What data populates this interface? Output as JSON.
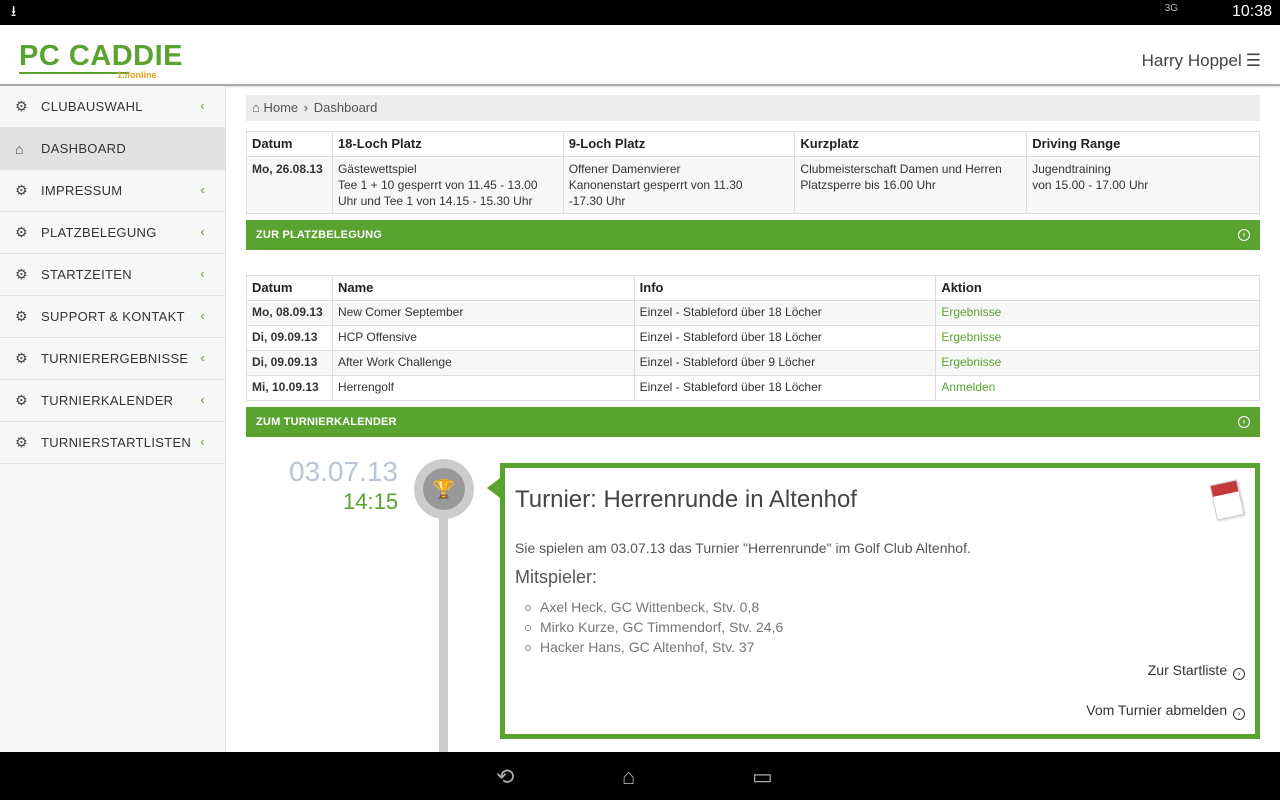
{
  "status_bar": {
    "time": "10:38",
    "download_icon": "download-icon",
    "network": "3G"
  },
  "header": {
    "logo_text": "PC CADDIE",
    "logo_sub": "1://online",
    "user_name": "Harry Hoppel",
    "menu_icon": "hamburger-icon"
  },
  "sidebar": {
    "items": [
      {
        "label": "CLUBAUSWAHL",
        "icon": "gears-icon",
        "active": false
      },
      {
        "label": "DASHBOARD",
        "icon": "home-icon",
        "active": true
      },
      {
        "label": "IMPRESSUM",
        "icon": "gears-icon",
        "active": false
      },
      {
        "label": "PLATZBELEGUNG",
        "icon": "gears-icon",
        "active": false
      },
      {
        "label": "STARTZEITEN",
        "icon": "gears-icon",
        "active": false
      },
      {
        "label": "SUPPORT & KONTAKT",
        "icon": "gears-icon",
        "active": false
      },
      {
        "label": "TURNIERERGEBNISSE",
        "icon": "gears-icon",
        "active": false
      },
      {
        "label": "TURNIERKALENDER",
        "icon": "gears-icon",
        "active": false
      },
      {
        "label": "TURNIERSTARTLISTEN",
        "icon": "gears-icon",
        "active": false
      }
    ]
  },
  "breadcrumb": {
    "home": "Home",
    "current": "Dashboard"
  },
  "occupancy": {
    "headers": [
      "Datum",
      "18-Loch Platz",
      "9-Loch Platz",
      "Kurzplatz",
      "Driving Range"
    ],
    "row": {
      "date": "Mo, 26.08.13",
      "loch18": [
        "Gästewettspiel",
        "Tee 1 + 10 gesperrt von 11.45 - 13.00",
        "Uhr und Tee 1 von 14.15 - 15.30 Uhr"
      ],
      "loch9": [
        "Offener Damenvierer",
        "Kanonenstart gesperrt von 11.30",
        "-17.30 Uhr"
      ],
      "kurz": [
        "Clubmeisterschaft Damen und Herren",
        "Platzsperre bis 16.00 Uhr"
      ],
      "range": [
        "Jugendtraining",
        "von 15.00 - 17.00 Uhr"
      ]
    },
    "button": "ZUR PLATZBELEGUNG"
  },
  "tournaments": {
    "headers": [
      "Datum",
      "Name",
      "Info",
      "Aktion"
    ],
    "rows": [
      {
        "date": "Mo, 08.09.13",
        "name": "New Comer September",
        "info": "Einzel - Stableford über 18 Löcher",
        "action": "Ergebnisse"
      },
      {
        "date": "Di, 09.09.13",
        "name": "HCP Offensive",
        "info": "Einzel - Stableford über 18 Löcher",
        "action": "Ergebnisse"
      },
      {
        "date": "Di, 09.09.13",
        "name": "After Work Challenge",
        "info": "Einzel - Stableford über 9 Löcher",
        "action": "Ergebnisse"
      },
      {
        "date": "Mi, 10.09.13",
        "name": "Herrengolf",
        "info": "Einzel - Stableford über 18 Löcher",
        "action": "Anmelden"
      }
    ],
    "button": "ZUM TURNIERKALENDER"
  },
  "timeline": {
    "date": "03.07.13",
    "time": "14:15",
    "node_icon": "trophy-icon",
    "card": {
      "title": "Turnier: Herrenrunde in Altenhof",
      "text": "Sie spielen am 03.07.13 das Turnier \"Herrenrunde\" im Golf Club Altenhof.",
      "players_heading": "Mitspieler:",
      "players": [
        "Axel Heck, GC Wittenbeck, Stv. 0,8",
        "Mirko Kurze, GC Timmendorf, Stv. 24,6",
        "Hacker Hans, GC Altenhof, Stv. 37"
      ],
      "action_startlist": "Zur Startliste",
      "action_unregister": "Vom Turnier abmelden",
      "doc_icon": "calendar-document-icon"
    }
  },
  "colors": {
    "accent": "#5aa330",
    "logo_sub": "#e8a11a",
    "date_muted": "#b9c5d4"
  }
}
